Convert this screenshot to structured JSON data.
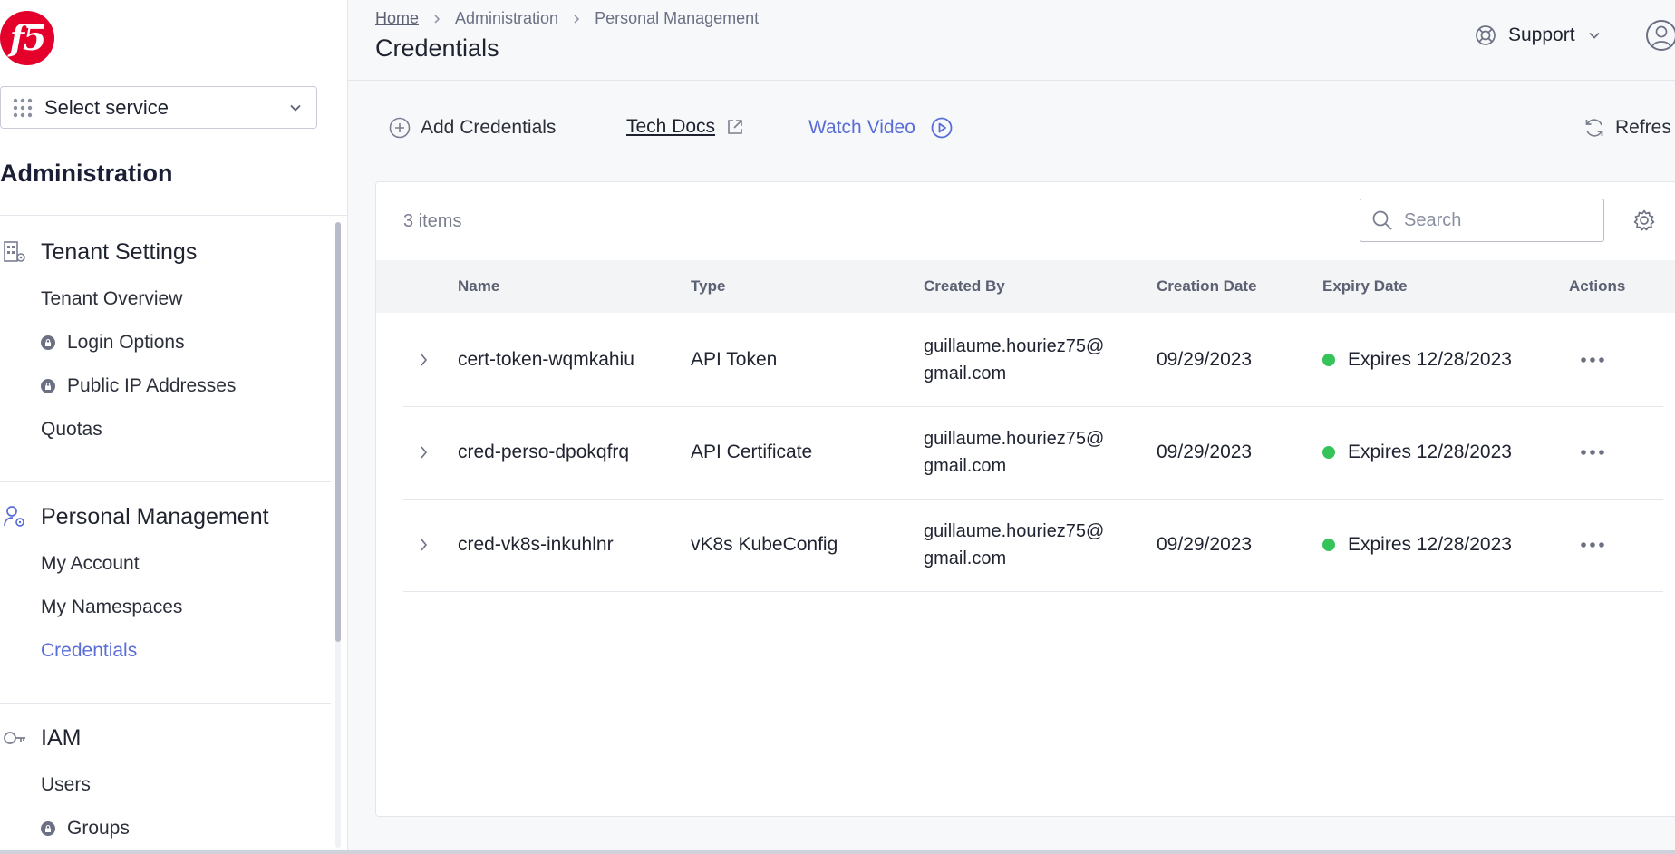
{
  "sidebar": {
    "logo_text": "f5",
    "service_select": {
      "label": "Select service"
    },
    "section_title": "Administration",
    "groups": [
      {
        "title": "Tenant Settings",
        "icon": "building-settings-icon",
        "items": [
          {
            "label": "Tenant Overview",
            "locked": false
          },
          {
            "label": "Login Options",
            "locked": true
          },
          {
            "label": "Public IP Addresses",
            "locked": true
          },
          {
            "label": "Quotas",
            "locked": false
          }
        ]
      },
      {
        "title": "Personal Management",
        "icon": "user-settings-icon",
        "items": [
          {
            "label": "My Account",
            "locked": false
          },
          {
            "label": "My Namespaces",
            "locked": false
          },
          {
            "label": "Credentials",
            "locked": false,
            "active": true
          }
        ]
      },
      {
        "title": "IAM",
        "icon": "key-icon",
        "items": [
          {
            "label": "Users",
            "locked": false
          },
          {
            "label": "Groups",
            "locked": true
          }
        ]
      }
    ]
  },
  "header": {
    "breadcrumb": [
      "Home",
      "Administration",
      "Personal Management"
    ],
    "title": "Credentials",
    "support_label": "Support"
  },
  "toolbar": {
    "add_label": "Add Credentials",
    "docs_label": "Tech Docs",
    "video_label": "Watch Video",
    "refresh_label": "Refres"
  },
  "table": {
    "items_count": "3 items",
    "search_placeholder": "Search",
    "columns": [
      "Name",
      "Type",
      "Created By",
      "Creation Date",
      "Expiry Date",
      "Actions"
    ],
    "rows": [
      {
        "name": "cert-token-wqmkahiu",
        "type": "API Token",
        "created_by_line1": "guillaume.houriez75@",
        "created_by_line2": "gmail.com",
        "creation_date": "09/29/2023",
        "expiry": "Expires 12/28/2023"
      },
      {
        "name": "cred-perso-dpokqfrq",
        "type": "API Certificate",
        "created_by_line1": "guillaume.houriez75@",
        "created_by_line2": "gmail.com",
        "creation_date": "09/29/2023",
        "expiry": "Expires 12/28/2023"
      },
      {
        "name": "cred-vk8s-inkuhlnr",
        "type": "vK8s KubeConfig",
        "created_by_line1": "guillaume.houriez75@",
        "created_by_line2": "gmail.com",
        "creation_date": "09/29/2023",
        "expiry": "Expires 12/28/2023"
      }
    ]
  },
  "colors": {
    "brand": "#e4002b",
    "accent": "#5a6dd7",
    "status_active": "#36c35a"
  }
}
